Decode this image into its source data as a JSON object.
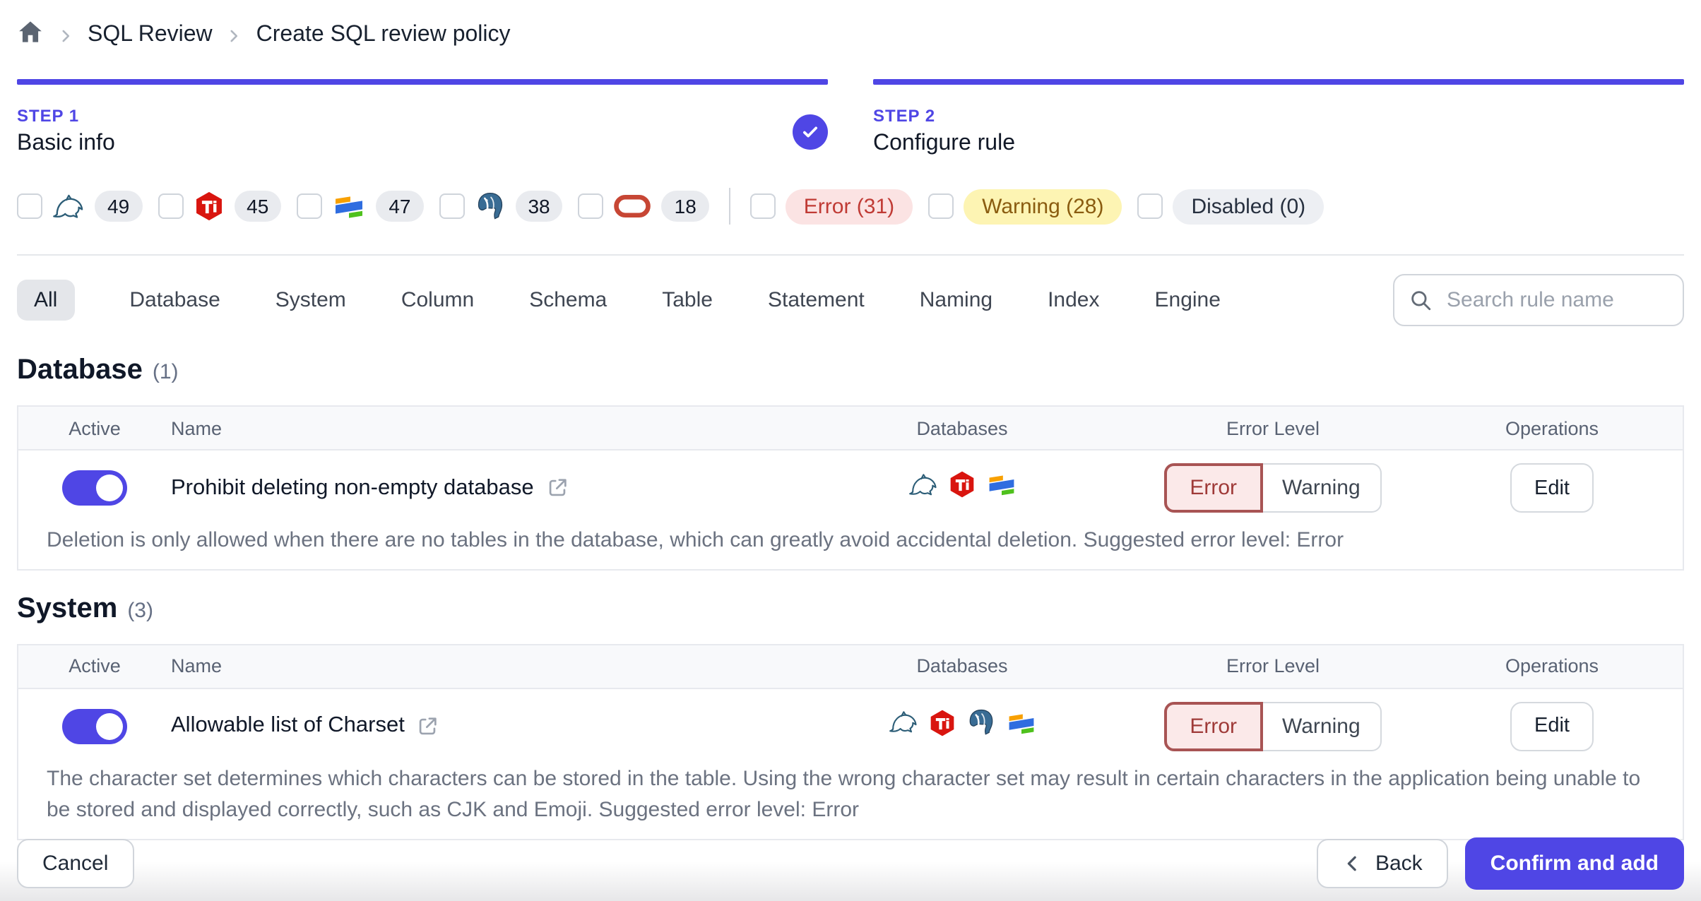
{
  "breadcrumb": {
    "items": [
      "SQL Review",
      "Create SQL review policy"
    ]
  },
  "steps": [
    {
      "label": "STEP 1",
      "title": "Basic info",
      "completed": true
    },
    {
      "label": "STEP 2",
      "title": "Configure rule",
      "completed": false
    }
  ],
  "filters": {
    "engines": [
      {
        "name": "MySQL",
        "count": "49"
      },
      {
        "name": "TiDB",
        "count": "45"
      },
      {
        "name": "OceanBase",
        "count": "47"
      },
      {
        "name": "PostgreSQL",
        "count": "38"
      },
      {
        "name": "Oracle",
        "count": "18"
      }
    ],
    "levels": [
      {
        "name": "error",
        "label": "Error (31)"
      },
      {
        "name": "warning",
        "label": "Warning (28)"
      },
      {
        "name": "disabled",
        "label": "Disabled (0)"
      }
    ]
  },
  "tabs": {
    "items": [
      "All",
      "Database",
      "System",
      "Column",
      "Schema",
      "Table",
      "Statement",
      "Naming",
      "Index",
      "Engine"
    ],
    "selected": "All"
  },
  "search": {
    "placeholder": "Search rule name"
  },
  "error_levels": {
    "error": "Error",
    "warning": "Warning"
  },
  "sections": [
    {
      "title": "Database",
      "count": "(1)",
      "columns": {
        "active": "Active",
        "name": "Name",
        "databases": "Databases",
        "error_level": "Error Level",
        "operations": "Operations"
      },
      "rows": [
        {
          "active": true,
          "name": "Prohibit deleting non-empty database",
          "databases": [
            "MySQL",
            "TiDB",
            "OceanBase"
          ],
          "selected_level": "Error",
          "edit_label": "Edit",
          "description": "Deletion is only allowed when there are no tables in the database, which can greatly avoid accidental deletion. Suggested error level: Error"
        }
      ]
    },
    {
      "title": "System",
      "count": "(3)",
      "columns": {
        "active": "Active",
        "name": "Name",
        "databases": "Databases",
        "error_level": "Error Level",
        "operations": "Operations"
      },
      "rows": [
        {
          "active": true,
          "name": "Allowable list of Charset",
          "databases": [
            "MySQL",
            "TiDB",
            "PostgreSQL",
            "OceanBase"
          ],
          "selected_level": "Error",
          "edit_label": "Edit",
          "description": "The character set determines which characters can be stored in the table. Using the wrong character set may result in certain characters in the application being unable to be stored and displayed correctly, such as CJK and Emoji. Suggested error level: Error"
        }
      ]
    }
  ],
  "footer": {
    "cancel": "Cancel",
    "back": "Back",
    "confirm": "Confirm and add"
  },
  "colors": {
    "accent": "#4f46e5",
    "error_text": "#9f3a38",
    "error_bg": "#fbe9e9",
    "warning_pill_bg": "#fdf4b3",
    "warning_pill_text": "#8a5c10",
    "disabled_pill_bg": "#edeff3"
  }
}
